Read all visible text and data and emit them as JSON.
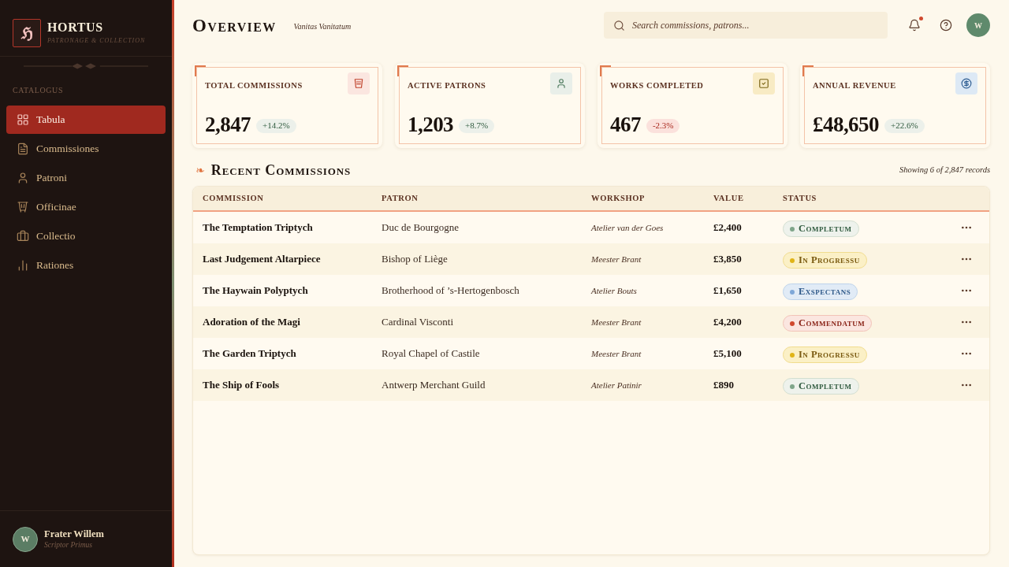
{
  "sidebar": {
    "logo": {
      "letter": "ℌ",
      "title": "HORTUS",
      "subtitle": "PATRONAGE & COLLECTION"
    },
    "section_label": "CATALOGUS",
    "items": [
      {
        "label": "Tabula",
        "selected": true
      },
      {
        "label": "Commissiones",
        "selected": false
      },
      {
        "label": "Patroni",
        "selected": false
      },
      {
        "label": "Officinae",
        "selected": false
      },
      {
        "label": "Collectio",
        "selected": false
      },
      {
        "label": "Rationes",
        "selected": false
      }
    ],
    "user": {
      "initial": "W",
      "name": "Frater Willem",
      "role": "Scriptor Primus"
    }
  },
  "header": {
    "title": "Overview",
    "subtitle": "Vanitas Vanitatum",
    "search": {
      "placeholder": "Search commissions, patrons..."
    },
    "notifications": {
      "unread": true
    },
    "avatar": {
      "initial": "W"
    }
  },
  "stats": [
    {
      "label": "TOTAL COMMISSIONS",
      "value": "2,847",
      "change": "+14.2%",
      "declining": false
    },
    {
      "label": "ACTIVE PATRONS",
      "value": "1,203",
      "change": "+8.7%",
      "declining": false
    },
    {
      "label": "WORKS COMPLETED",
      "value": "467",
      "change": "-2.3%",
      "declining": true
    },
    {
      "label": "ANNUAL REVENUE",
      "value": "£48,650",
      "change": "+22.6%",
      "declining": false
    }
  ],
  "recent": {
    "ornament": "❧",
    "title": "Recent Commissions",
    "summary": "Showing 6 of 2,847 records",
    "columns": [
      "COMMISSION",
      "PATRON",
      "WORKSHOP",
      "VALUE",
      "STATUS"
    ],
    "rows": [
      {
        "commission": "The Temptation Triptych",
        "patron": "Duc de Bourgogne",
        "workshop": "Atelier van der Goes",
        "value": "£2,400",
        "status": {
          "label": "Completum",
          "kind": "done"
        }
      },
      {
        "commission": "Last Judgement Altarpiece",
        "patron": "Bishop of Liège",
        "workshop": "Meester Brant",
        "value": "£3,850",
        "status": {
          "label": "In Progressu",
          "kind": "progress"
        }
      },
      {
        "commission": "The Haywain Polyptych",
        "patron": "Brotherhood of ’s-Hertogenbosch",
        "workshop": "Atelier Bouts",
        "value": "£1,650",
        "status": {
          "label": "Exspectans",
          "kind": "waiting"
        }
      },
      {
        "commission": "Adoration of the Magi",
        "patron": "Cardinal Visconti",
        "workshop": "Meester Brant",
        "value": "£4,200",
        "status": {
          "label": "Commendatum",
          "kind": "flagged"
        }
      },
      {
        "commission": "The Garden Triptych",
        "patron": "Royal Chapel of Castile",
        "workshop": "Meester Brant",
        "value": "£5,100",
        "status": {
          "label": "In Progressu",
          "kind": "progress"
        }
      },
      {
        "commission": "The Ship of Fools",
        "patron": "Antwerp Merchant Guild",
        "workshop": "Atelier Patinir",
        "value": "£890",
        "status": {
          "label": "Completum",
          "kind": "done"
        }
      }
    ]
  }
}
